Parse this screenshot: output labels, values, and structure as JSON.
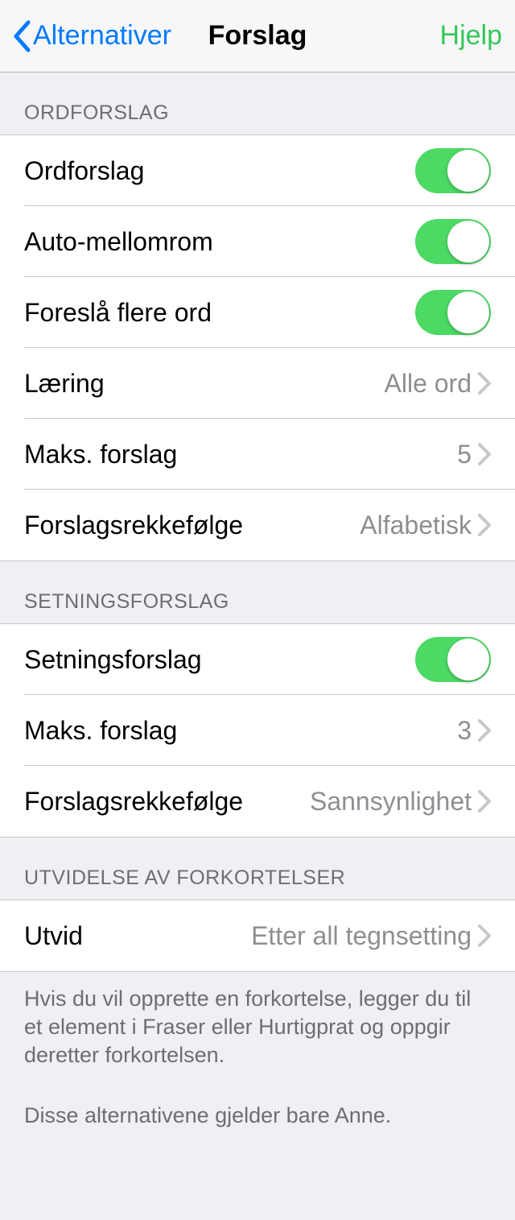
{
  "nav": {
    "back": "Alternativer",
    "title": "Forslag",
    "help": "Hjelp"
  },
  "sections": {
    "word": {
      "header": "ORDFORSLAG",
      "rows": {
        "ordforslag": {
          "label": "Ordforslag",
          "on": true
        },
        "automellomrom": {
          "label": "Auto-mellomrom",
          "on": true
        },
        "flereord": {
          "label": "Foreslå flere ord",
          "on": true
        },
        "laering": {
          "label": "Læring",
          "value": "Alle ord"
        },
        "maks": {
          "label": "Maks. forslag",
          "value": "5"
        },
        "rekkefolge": {
          "label": "Forslagsrekkefølge",
          "value": "Alfabetisk"
        }
      }
    },
    "sentence": {
      "header": "SETNINGSFORSLAG",
      "rows": {
        "setningsforslag": {
          "label": "Setningsforslag",
          "on": true
        },
        "maks": {
          "label": "Maks. forslag",
          "value": "3"
        },
        "rekkefolge": {
          "label": "Forslagsrekkefølge",
          "value": "Sannsynlighet"
        }
      }
    },
    "abbrev": {
      "header": "UTVIDELSE AV FORKORTELSER",
      "rows": {
        "utvid": {
          "label": "Utvid",
          "value": "Etter all tegnsetting"
        }
      },
      "footer1": "Hvis du vil opprette en forkortelse, legger du til et element i Fraser eller Hurtigprat og oppgir deretter forkortelsen.",
      "footer2": "Disse alternativene gjelder bare Anne."
    }
  }
}
